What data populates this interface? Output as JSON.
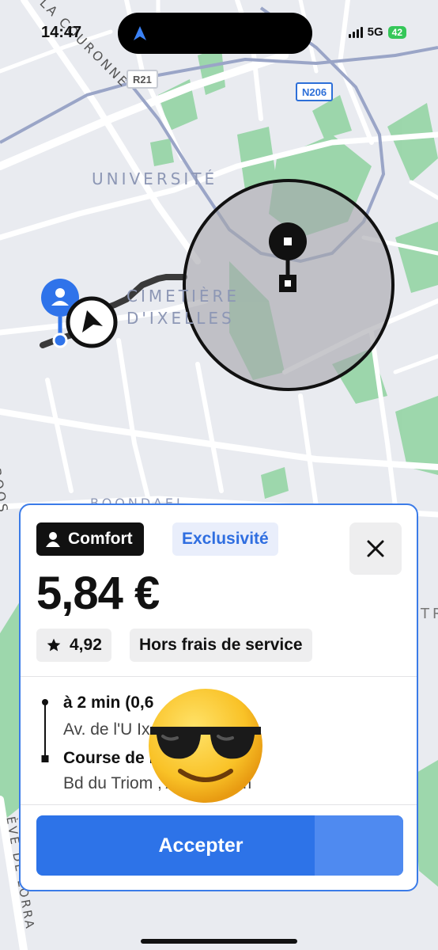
{
  "status_bar": {
    "time": "14:47",
    "network": "5G",
    "battery": "42"
  },
  "map": {
    "labels": {
      "universite": "UNIVERSITÉ",
      "cimetiere_line1": "CIMETIÈRE",
      "cimetiere_line2": "D'IXELLES",
      "couronne": "LA COURONNE",
      "roos": "ROOS",
      "boondael": "BOONDAEL",
      "lorraine": "ÈVE DE LORRA",
      "right_edge": "TR"
    },
    "shields": {
      "r21": "R21",
      "n206": "N206"
    },
    "icons": [
      "driver-navigation-icon",
      "passenger-icon",
      "pickup-marker-icon",
      "dropoff-marker-icon"
    ],
    "colors": {
      "background": "#e9ebf0",
      "park": "#8fd3a0",
      "road": "#ffffff",
      "highway": "#9aa5c7",
      "zone": "#a7a7ad",
      "passenger": "#2f73ea"
    }
  },
  "offer_card": {
    "category": "Comfort",
    "badge": "Exclusivité",
    "price": "5,84 €",
    "rating": "4,92",
    "fee_note": "Hors frais de service",
    "pickup_eta": "à 2 min (0,6",
    "pickup_address": "Av. de l'U              Ixelles",
    "trip_line": "Course de          km)",
    "dropoff_address": "Bd du Triom              , Auderghem",
    "accept_label": "Accepter",
    "colors": {
      "accent": "#2d73e8",
      "badge_bg": "#e9eefb",
      "badge_text": "#2f6ee0"
    }
  }
}
